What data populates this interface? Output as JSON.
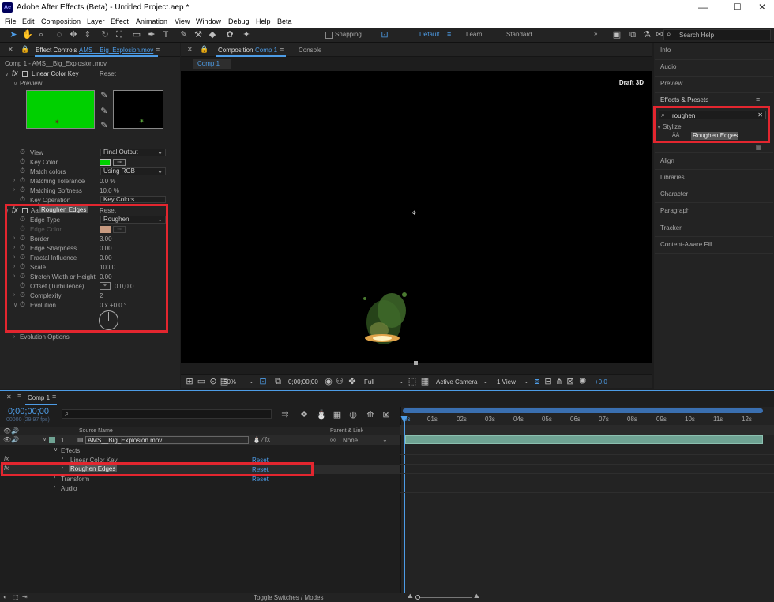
{
  "window": {
    "title": "Adobe After Effects (Beta) - Untitled Project.aep *",
    "logo": "Ae",
    "minimize": "—",
    "maximize": "☐",
    "close": "✕"
  },
  "menu": [
    "File",
    "Edit",
    "Composition",
    "Layer",
    "Effect",
    "Animation",
    "View",
    "Window",
    "Debug",
    "Help",
    "Beta"
  ],
  "toolbar": {
    "snapping": "Snapping",
    "workspaces": [
      "Default",
      "Learn",
      "Standard"
    ],
    "search_placeholder": "Search Help",
    "more": "»"
  },
  "effect_controls": {
    "tab_title": "Effect Controls",
    "tab_file": "AMS__Big_Explosion.mov",
    "breadcrumb": "Comp 1 - AMS__Big_Explosion.mov",
    "lck": {
      "fx": "fx",
      "name": "Linear Color Key",
      "reset": "Reset",
      "preview": "Preview",
      "props": [
        {
          "label": "View",
          "value": "Final Output"
        },
        {
          "label": "Key Color",
          "value": ""
        },
        {
          "label": "Match colors",
          "value": "Using RGB"
        },
        {
          "label": "Matching Tolerance",
          "value": "0.0 %"
        },
        {
          "label": "Matching Softness",
          "value": "10.0 %"
        },
        {
          "label": "Key Operation",
          "value": "Key Colors"
        }
      ]
    },
    "re": {
      "fx": "fx",
      "name": "Roughen Edges",
      "reset": "Reset",
      "props": [
        {
          "label": "Edge Type",
          "value": "Roughen"
        },
        {
          "label": "Edge Color",
          "value": ""
        },
        {
          "label": "Border",
          "value": "3.00"
        },
        {
          "label": "Edge Sharpness",
          "value": "0.00"
        },
        {
          "label": "Fractal Influence",
          "value": "0.00"
        },
        {
          "label": "Scale",
          "value": "100.0"
        },
        {
          "label": "Stretch Width or Height",
          "value": "0.00"
        },
        {
          "label": "Offset (Turbulence)",
          "value": "0.0,0.0"
        },
        {
          "label": "Complexity",
          "value": "2"
        },
        {
          "label": "Evolution",
          "value": "0 x +0.0 °"
        }
      ],
      "evolution_options": "Evolution Options"
    }
  },
  "composition": {
    "tab_title": "Composition",
    "tab_comp": "Comp 1",
    "console": "Console",
    "sub_tab": "Comp 1",
    "draft": "Draft 3D",
    "footer": {
      "zoom": "50%",
      "timecode": "0;00;00;00",
      "resolution": "Full",
      "camera": "Active Camera",
      "views": "1 View",
      "exposure": "+0.0"
    }
  },
  "right_panel": {
    "top": [
      "Info",
      "Audio",
      "Preview"
    ],
    "effects_presets": "Effects & Presets",
    "search_value": "roughen",
    "group": "Stylize",
    "result": "Roughen Edges",
    "bottom": [
      "Align",
      "Libraries",
      "Character",
      "Paragraph",
      "Tracker",
      "Content-Aware Fill"
    ]
  },
  "timeline": {
    "tab": "Comp 1",
    "timecode": "0;00;00;00",
    "fps": "00000 (29.97 fps)",
    "col_source": "Source Name",
    "col_parent": "Parent & Link",
    "layer": {
      "num": "1",
      "name": "AMS__Big_Explosion.mov",
      "parent": "None"
    },
    "rows": [
      {
        "label": "Effects"
      },
      {
        "label": "Linear Color Key",
        "reset": "Reset"
      },
      {
        "label": "Roughen Edges",
        "reset": "Reset"
      },
      {
        "label": "Transform",
        "reset": "Reset"
      },
      {
        "label": "Audio"
      }
    ],
    "ruler": [
      "0s",
      "01s",
      "02s",
      "03s",
      "04s",
      "05s",
      "06s",
      "07s",
      "08s",
      "09s",
      "10s",
      "11s",
      "12s"
    ],
    "toggle": "Toggle Switches / Modes"
  },
  "colors": {
    "accent": "#4d9ce6",
    "highlight": "#e3262f",
    "key_green": "#00d000",
    "edge_color": "#c89a80",
    "layer_bar": "#6fa393"
  }
}
